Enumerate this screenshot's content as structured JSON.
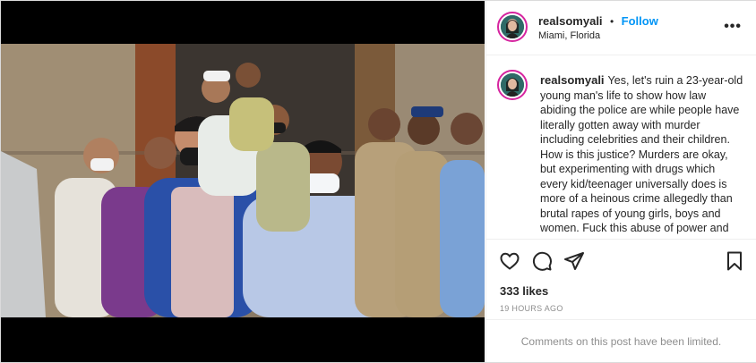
{
  "post": {
    "username": "realsomyali",
    "separator": "•",
    "follow_label": "Follow",
    "location": "Miami, Florida",
    "more_label": "•••",
    "caption": "Yes, let's ruin a 23-year-old young man's life to show how law abiding the police are while people have literally gotten away with murder including celebrities and their children. How is this justice? Murders are okay, but experimenting with drugs which every kid/teenager universally does is more of a heinous crime allegedly than brutal rapes of young girls, boys and women. Fuck this abuse of power and",
    "likes": "333 likes",
    "time": "19 HOURS AGO",
    "comments_limited": "Comments on this post have been limited."
  },
  "icons": {
    "like": "heart-icon",
    "comment": "comment-icon",
    "share": "paper-plane-icon",
    "save": "bookmark-icon"
  },
  "colors": {
    "accent": "#0095f6",
    "text": "#262626",
    "muted": "#8e8e8e",
    "avatar_ring": "#d6249f"
  }
}
